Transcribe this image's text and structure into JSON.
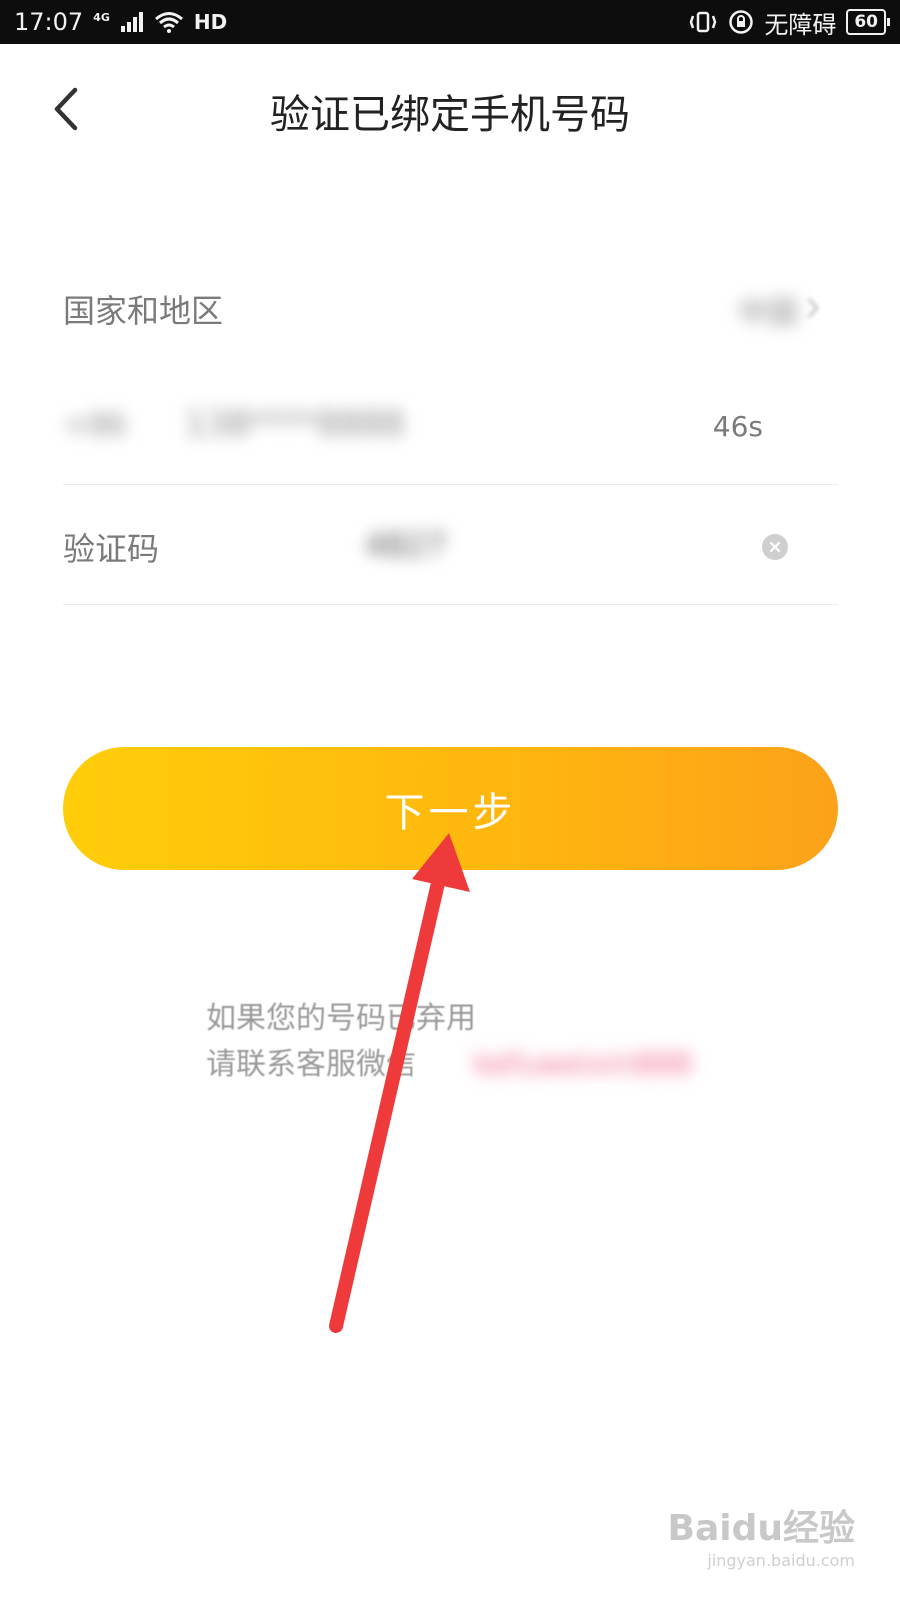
{
  "status_bar": {
    "time": "17:07",
    "network": "4G",
    "hd": "HD",
    "accessibility": "无障碍",
    "battery": "60",
    "icons": [
      "signal-icon",
      "wifi-icon",
      "hd-call-icon",
      "vibrate-icon",
      "rotation-lock-icon",
      "battery-icon"
    ]
  },
  "header": {
    "back_icon": "chevron-left-icon",
    "title": "验证已绑定手机号码"
  },
  "form": {
    "region_label": "国家和地区",
    "region_value": "中国",
    "country_code": "+86",
    "phone_number": "138****8888",
    "countdown": "46s",
    "code_label": "验证码",
    "code_value": "4827",
    "clear_icon": "clear-circle-icon"
  },
  "next_button": {
    "label": "下一步",
    "gradient_start": "#ffcd0a",
    "gradient_end": "#fca21a"
  },
  "notice": {
    "line1": "如果您的号码已弃用",
    "line2": "请联系客服微信",
    "contact": "kefuweixin888"
  },
  "annotation": {
    "arrow_color": "#ee3a3a"
  },
  "watermark": {
    "brand": "Baidu经验",
    "url": "jingyan.baidu.com"
  }
}
